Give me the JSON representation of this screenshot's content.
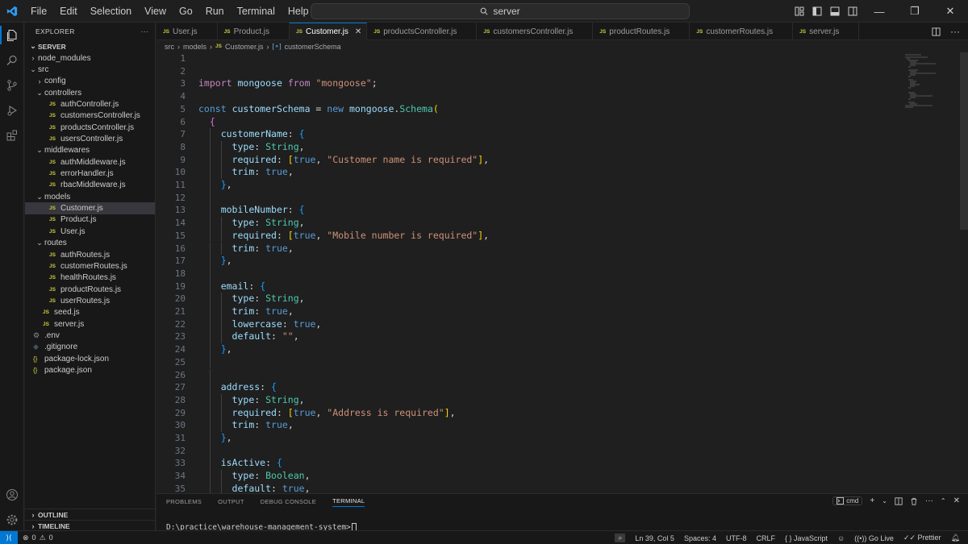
{
  "menu": [
    "File",
    "Edit",
    "Selection",
    "View",
    "Go",
    "Run",
    "Terminal",
    "Help"
  ],
  "search": {
    "text": "server"
  },
  "explorer": {
    "title": "EXPLORER",
    "root": "SERVER",
    "items": [
      {
        "label": "node_modules",
        "kind": "folder",
        "open": false,
        "depth": 0
      },
      {
        "label": "src",
        "kind": "folder",
        "open": true,
        "depth": 0
      },
      {
        "label": "config",
        "kind": "folder",
        "open": false,
        "depth": 1
      },
      {
        "label": "controllers",
        "kind": "folder",
        "open": true,
        "depth": 1
      },
      {
        "label": "authController.js",
        "kind": "js",
        "depth": 2
      },
      {
        "label": "customersController.js",
        "kind": "js",
        "depth": 2
      },
      {
        "label": "productsController.js",
        "kind": "js",
        "depth": 2
      },
      {
        "label": "usersController.js",
        "kind": "js",
        "depth": 2
      },
      {
        "label": "middlewares",
        "kind": "folder",
        "open": true,
        "depth": 1
      },
      {
        "label": "authMiddleware.js",
        "kind": "js",
        "depth": 2
      },
      {
        "label": "errorHandler.js",
        "kind": "js",
        "depth": 2
      },
      {
        "label": "rbacMiddleware.js",
        "kind": "js",
        "depth": 2
      },
      {
        "label": "models",
        "kind": "folder",
        "open": true,
        "depth": 1
      },
      {
        "label": "Customer.js",
        "kind": "js",
        "depth": 2,
        "selected": true
      },
      {
        "label": "Product.js",
        "kind": "js",
        "depth": 2
      },
      {
        "label": "User.js",
        "kind": "js",
        "depth": 2
      },
      {
        "label": "routes",
        "kind": "folder",
        "open": true,
        "depth": 1
      },
      {
        "label": "authRoutes.js",
        "kind": "js",
        "depth": 2
      },
      {
        "label": "customerRoutes.js",
        "kind": "js",
        "depth": 2
      },
      {
        "label": "healthRoutes.js",
        "kind": "js",
        "depth": 2
      },
      {
        "label": "productRoutes.js",
        "kind": "js",
        "depth": 2
      },
      {
        "label": "userRoutes.js",
        "kind": "js",
        "depth": 2
      },
      {
        "label": "seed.js",
        "kind": "js",
        "depth": 1
      },
      {
        "label": "server.js",
        "kind": "js",
        "depth": 1
      },
      {
        "label": ".env",
        "kind": "env",
        "depth": 0
      },
      {
        "label": ".gitignore",
        "kind": "git",
        "depth": 0
      },
      {
        "label": "package-lock.json",
        "kind": "json",
        "depth": 0
      },
      {
        "label": "package.json",
        "kind": "json",
        "depth": 0
      }
    ],
    "outline": "OUTLINE",
    "timeline": "TIMELINE"
  },
  "tabs": [
    {
      "label": "User.js",
      "active": false
    },
    {
      "label": "Product.js",
      "active": false
    },
    {
      "label": "Customer.js",
      "active": true
    },
    {
      "label": "productsController.js",
      "active": false
    },
    {
      "label": "customersController.js",
      "active": false
    },
    {
      "label": "productRoutes.js",
      "active": false
    },
    {
      "label": "customerRoutes.js",
      "active": false
    },
    {
      "label": "server.js",
      "active": false
    }
  ],
  "breadcrumb": [
    "src",
    "models",
    "Customer.js",
    "customerSchema"
  ],
  "js_badge": "JS",
  "code": [
    {
      "n": "1",
      "t": [],
      "indent": 0
    },
    {
      "n": "2",
      "t": [],
      "indent": 0
    },
    {
      "n": "3",
      "t": [
        [
          "kw",
          "import"
        ],
        [
          "pun",
          " "
        ],
        [
          "var",
          "mongoose"
        ],
        [
          "pun",
          " "
        ],
        [
          "kw",
          "from"
        ],
        [
          "pun",
          " "
        ],
        [
          "str",
          "\"mongoose\""
        ],
        [
          "pun",
          ";"
        ]
      ],
      "indent": 0
    },
    {
      "n": "4",
      "t": [],
      "indent": 0
    },
    {
      "n": "5",
      "t": [
        [
          "def",
          "const"
        ],
        [
          "pun",
          " "
        ],
        [
          "var",
          "customerSchema"
        ],
        [
          "pun",
          " = "
        ],
        [
          "def",
          "new"
        ],
        [
          "pun",
          " "
        ],
        [
          "var",
          "mongoose"
        ],
        [
          "pun",
          "."
        ],
        [
          "cls",
          "Schema"
        ],
        [
          "b1",
          "("
        ]
      ],
      "indent": 0
    },
    {
      "n": "6",
      "t": [
        [
          "pun",
          "  "
        ],
        [
          "b2",
          "{"
        ]
      ],
      "indent": 0
    },
    {
      "n": "7",
      "t": [
        [
          "pun",
          "    "
        ],
        [
          "var",
          "customerName"
        ],
        [
          "pun",
          ": "
        ],
        [
          "b3",
          "{"
        ]
      ],
      "indent": 1
    },
    {
      "n": "8",
      "t": [
        [
          "pun",
          "      "
        ],
        [
          "var",
          "type"
        ],
        [
          "pun",
          ": "
        ],
        [
          "cls",
          "String"
        ],
        [
          "pun",
          ","
        ]
      ],
      "indent": 2
    },
    {
      "n": "9",
      "t": [
        [
          "pun",
          "      "
        ],
        [
          "var",
          "required"
        ],
        [
          "pun",
          ": "
        ],
        [
          "b1",
          "["
        ],
        [
          "def",
          "true"
        ],
        [
          "pun",
          ", "
        ],
        [
          "str",
          "\"Customer name is required\""
        ],
        [
          "b1",
          "]"
        ],
        [
          "pun",
          ","
        ]
      ],
      "indent": 2
    },
    {
      "n": "10",
      "t": [
        [
          "pun",
          "      "
        ],
        [
          "var",
          "trim"
        ],
        [
          "pun",
          ": "
        ],
        [
          "def",
          "true"
        ],
        [
          "pun",
          ","
        ]
      ],
      "indent": 2
    },
    {
      "n": "11",
      "t": [
        [
          "pun",
          "    "
        ],
        [
          "b3",
          "}"
        ],
        [
          "pun",
          ","
        ]
      ],
      "indent": 1
    },
    {
      "n": "12",
      "t": [],
      "indent": 1
    },
    {
      "n": "13",
      "t": [
        [
          "pun",
          "    "
        ],
        [
          "var",
          "mobileNumber"
        ],
        [
          "pun",
          ": "
        ],
        [
          "b3",
          "{"
        ]
      ],
      "indent": 1
    },
    {
      "n": "14",
      "t": [
        [
          "pun",
          "      "
        ],
        [
          "var",
          "type"
        ],
        [
          "pun",
          ": "
        ],
        [
          "cls",
          "String"
        ],
        [
          "pun",
          ","
        ]
      ],
      "indent": 2
    },
    {
      "n": "15",
      "t": [
        [
          "pun",
          "      "
        ],
        [
          "var",
          "required"
        ],
        [
          "pun",
          ": "
        ],
        [
          "b1",
          "["
        ],
        [
          "def",
          "true"
        ],
        [
          "pun",
          ", "
        ],
        [
          "str",
          "\"Mobile number is required\""
        ],
        [
          "b1",
          "]"
        ],
        [
          "pun",
          ","
        ]
      ],
      "indent": 2
    },
    {
      "n": "16",
      "t": [
        [
          "pun",
          "      "
        ],
        [
          "var",
          "trim"
        ],
        [
          "pun",
          ": "
        ],
        [
          "def",
          "true"
        ],
        [
          "pun",
          ","
        ]
      ],
      "indent": 2
    },
    {
      "n": "17",
      "t": [
        [
          "pun",
          "    "
        ],
        [
          "b3",
          "}"
        ],
        [
          "pun",
          ","
        ]
      ],
      "indent": 1
    },
    {
      "n": "18",
      "t": [],
      "indent": 1
    },
    {
      "n": "19",
      "t": [
        [
          "pun",
          "    "
        ],
        [
          "var",
          "email"
        ],
        [
          "pun",
          ": "
        ],
        [
          "b3",
          "{"
        ]
      ],
      "indent": 1
    },
    {
      "n": "20",
      "t": [
        [
          "pun",
          "      "
        ],
        [
          "var",
          "type"
        ],
        [
          "pun",
          ": "
        ],
        [
          "cls",
          "String"
        ],
        [
          "pun",
          ","
        ]
      ],
      "indent": 2
    },
    {
      "n": "21",
      "t": [
        [
          "pun",
          "      "
        ],
        [
          "var",
          "trim"
        ],
        [
          "pun",
          ": "
        ],
        [
          "def",
          "true"
        ],
        [
          "pun",
          ","
        ]
      ],
      "indent": 2
    },
    {
      "n": "22",
      "t": [
        [
          "pun",
          "      "
        ],
        [
          "var",
          "lowercase"
        ],
        [
          "pun",
          ": "
        ],
        [
          "def",
          "true"
        ],
        [
          "pun",
          ","
        ]
      ],
      "indent": 2
    },
    {
      "n": "23",
      "t": [
        [
          "pun",
          "      "
        ],
        [
          "var",
          "default"
        ],
        [
          "pun",
          ": "
        ],
        [
          "str",
          "\"\""
        ],
        [
          "pun",
          ","
        ]
      ],
      "indent": 2
    },
    {
      "n": "24",
      "t": [
        [
          "pun",
          "    "
        ],
        [
          "b3",
          "}"
        ],
        [
          "pun",
          ","
        ]
      ],
      "indent": 1
    },
    {
      "n": "25",
      "t": [],
      "indent": 1
    },
    {
      "n": "26",
      "t": [],
      "indent": 1
    },
    {
      "n": "27",
      "t": [
        [
          "pun",
          "    "
        ],
        [
          "var",
          "address"
        ],
        [
          "pun",
          ": "
        ],
        [
          "b3",
          "{"
        ]
      ],
      "indent": 1
    },
    {
      "n": "28",
      "t": [
        [
          "pun",
          "      "
        ],
        [
          "var",
          "type"
        ],
        [
          "pun",
          ": "
        ],
        [
          "cls",
          "String"
        ],
        [
          "pun",
          ","
        ]
      ],
      "indent": 2
    },
    {
      "n": "29",
      "t": [
        [
          "pun",
          "      "
        ],
        [
          "var",
          "required"
        ],
        [
          "pun",
          ": "
        ],
        [
          "b1",
          "["
        ],
        [
          "def",
          "true"
        ],
        [
          "pun",
          ", "
        ],
        [
          "str",
          "\"Address is required\""
        ],
        [
          "b1",
          "]"
        ],
        [
          "pun",
          ","
        ]
      ],
      "indent": 2
    },
    {
      "n": "30",
      "t": [
        [
          "pun",
          "      "
        ],
        [
          "var",
          "trim"
        ],
        [
          "pun",
          ": "
        ],
        [
          "def",
          "true"
        ],
        [
          "pun",
          ","
        ]
      ],
      "indent": 2
    },
    {
      "n": "31",
      "t": [
        [
          "pun",
          "    "
        ],
        [
          "b3",
          "}"
        ],
        [
          "pun",
          ","
        ]
      ],
      "indent": 1
    },
    {
      "n": "32",
      "t": [],
      "indent": 1
    },
    {
      "n": "33",
      "t": [
        [
          "pun",
          "    "
        ],
        [
          "var",
          "isActive"
        ],
        [
          "pun",
          ": "
        ],
        [
          "b3",
          "{"
        ]
      ],
      "indent": 1
    },
    {
      "n": "34",
      "t": [
        [
          "pun",
          "      "
        ],
        [
          "var",
          "type"
        ],
        [
          "pun",
          ": "
        ],
        [
          "cls",
          "Boolean"
        ],
        [
          "pun",
          ","
        ]
      ],
      "indent": 2
    },
    {
      "n": "35",
      "t": [
        [
          "pun",
          "      "
        ],
        [
          "var",
          "default"
        ],
        [
          "pun",
          ": "
        ],
        [
          "def",
          "true"
        ],
        [
          "pun",
          ","
        ]
      ],
      "indent": 2
    }
  ],
  "panel": {
    "tabs": [
      "PROBLEMS",
      "OUTPUT",
      "DEBUG CONSOLE",
      "TERMINAL"
    ],
    "active_tab": "TERMINAL",
    "shell": "cmd",
    "prompt": "D:\\practice\\warehouse-management-system>"
  },
  "status": {
    "errors": "0",
    "warnings": "0",
    "position": "Ln 39, Col 5",
    "spaces": "Spaces: 4",
    "encoding": "UTF-8",
    "eol": "CRLF",
    "language": "JavaScript",
    "golive": "Go Live",
    "prettier": "Prettier"
  },
  "colors": {
    "accent": "#0078d4",
    "keyword": "#c586c0",
    "string": "#ce9178",
    "class": "#4ec9b0",
    "variable": "#9cdcfe"
  }
}
